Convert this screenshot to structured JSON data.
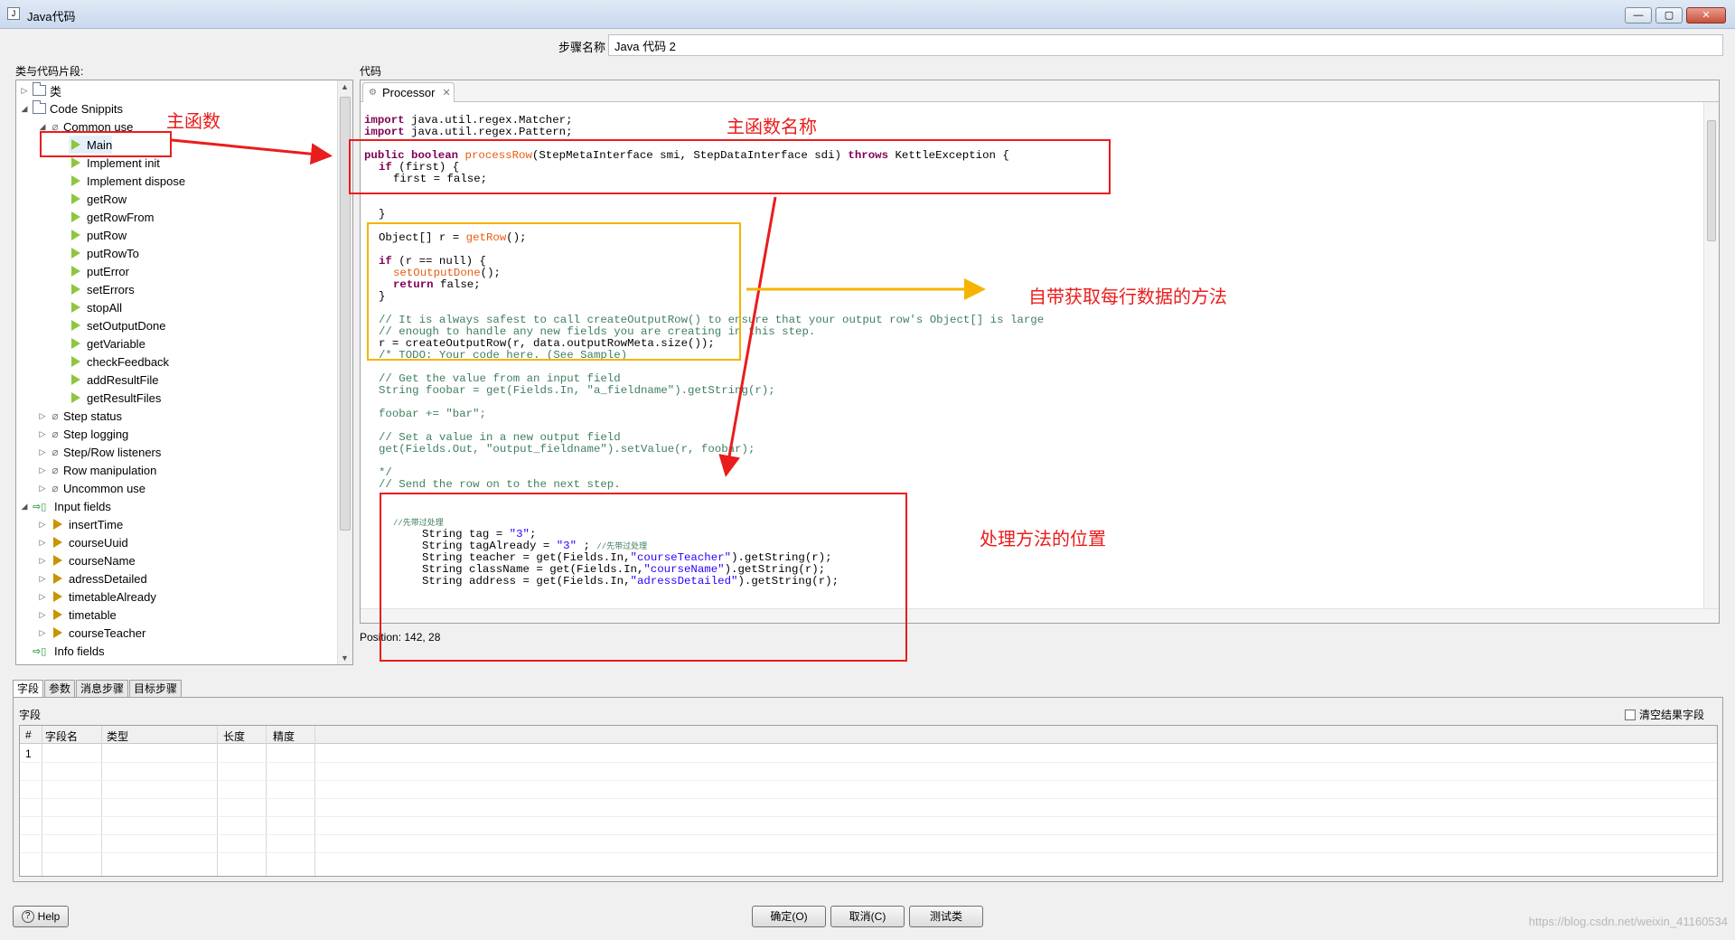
{
  "window": {
    "title": "Java代码",
    "minimize_icon": "minimize-icon",
    "maximize_icon": "maximize-icon",
    "close_icon": "close-icon"
  },
  "step_name": {
    "label": "步骤名称",
    "value": "Java 代码 2"
  },
  "left_panel": {
    "label": "类与代码片段:",
    "tree": [
      {
        "label": "类",
        "icon": "folder-icon"
      },
      {
        "label": "Code Snippits",
        "icon": "folder-icon"
      },
      {
        "label": "Common use",
        "icon": "clip-icon"
      },
      {
        "label": "Main",
        "icon": "snippet-icon"
      },
      {
        "label": "Implement init",
        "icon": "snippet-icon"
      },
      {
        "label": "Implement dispose",
        "icon": "snippet-icon"
      },
      {
        "label": "getRow",
        "icon": "snippet-icon"
      },
      {
        "label": "getRowFrom",
        "icon": "snippet-icon"
      },
      {
        "label": "putRow",
        "icon": "snippet-icon"
      },
      {
        "label": "putRowTo",
        "icon": "snippet-icon"
      },
      {
        "label": "putError",
        "icon": "snippet-icon"
      },
      {
        "label": "setErrors",
        "icon": "snippet-icon"
      },
      {
        "label": "stopAll",
        "icon": "snippet-icon"
      },
      {
        "label": "setOutputDone",
        "icon": "snippet-icon"
      },
      {
        "label": "getVariable",
        "icon": "snippet-icon"
      },
      {
        "label": "checkFeedback",
        "icon": "snippet-icon"
      },
      {
        "label": "addResultFile",
        "icon": "snippet-icon"
      },
      {
        "label": "getResultFiles",
        "icon": "snippet-icon"
      },
      {
        "label": "Step status",
        "icon": "clip-icon"
      },
      {
        "label": "Step logging",
        "icon": "clip-icon"
      },
      {
        "label": "Step/Row listeners",
        "icon": "clip-icon"
      },
      {
        "label": "Row manipulation",
        "icon": "clip-icon"
      },
      {
        "label": "Uncommon use",
        "icon": "clip-icon"
      },
      {
        "label": "Input fields",
        "icon": "fields-icon"
      },
      {
        "label": "insertTime",
        "icon": "field-icon"
      },
      {
        "label": "courseUuid",
        "icon": "field-icon"
      },
      {
        "label": "courseName",
        "icon": "field-icon"
      },
      {
        "label": "adressDetailed",
        "icon": "field-icon"
      },
      {
        "label": "timetableAlready",
        "icon": "field-icon"
      },
      {
        "label": "timetable",
        "icon": "field-icon"
      },
      {
        "label": "courseTeacher",
        "icon": "field-icon"
      },
      {
        "label": "Info fields",
        "icon": "fields-icon"
      }
    ]
  },
  "code_panel": {
    "label": "代码",
    "tab_label": "Processor",
    "position": "Position: 142, 28"
  },
  "code": {
    "l1_kw": "import",
    "l1_rest": " java.util.regex.Matcher;",
    "l2_kw": "import",
    "l2_rest": " java.util.regex.Pattern;",
    "l3_kw1": "public boolean",
    "l3_fn": "processRow",
    "l3_mid": "(StepMetaInterface smi, StepDataInterface sdi) ",
    "l3_kw2": "throws",
    "l3_rest": " KettleException {",
    "l4_kw": "if",
    "l4_rest": " (first) {",
    "l5": "first = false;",
    "l6": "}",
    "l7_a": "Object[] r = ",
    "l7_fn": "getRow",
    "l7_b": "();",
    "l8_kw": "if",
    "l8_rest": " (r == null) {",
    "l9_fn": "setOutputDone",
    "l9_rest": "();",
    "l10_kw": "return",
    "l10_rest": " false;",
    "l11": "}",
    "l12": "// It is always safest to call createOutputRow() to ensure that your output row's Object[] is large",
    "l13": "// enough to handle any new fields you are creating in this step.",
    "l14": "r = createOutputRow(r, data.outputRowMeta.size());",
    "l15": "/* TODO: Your code here. (See Sample)",
    "l16": "// Get the value from an input field",
    "l17_a": "String foobar = get(Fields.In, ",
    "l17_str": "\"a_fieldname\"",
    "l17_b": ").getString(r);",
    "l18_a": "foobar += ",
    "l18_str": "\"bar\"",
    "l18_b": ";",
    "l19": "// Set a value in a new output field",
    "l20_a": "get(Fields.Out, ",
    "l20_str": "\"output_fieldname\"",
    "l20_b": ").setValue(r, foobar);",
    "l21": "*/",
    "l22": "// Send the row on to the next step.",
    "l23": "//先带过处理",
    "l24_a": "String tag = ",
    "l24_str": "\"3\"",
    "l24_b": ";",
    "l25_a": "String tagAlready = ",
    "l25_str": "\"3\"",
    "l25_b": " ; ",
    "l25_cmt": "//先带过处理",
    "l26_a": "String teacher = get(Fields.In,",
    "l26_str": "\"courseTeacher\"",
    "l26_b": ").getString(r);",
    "l27_a": "String className = get(Fields.In,",
    "l27_str": "\"courseName\"",
    "l27_b": ").getString(r);",
    "l28_a": "String address = get(Fields.In,",
    "l28_str": "\"adressDetailed\"",
    "l28_b": ").getString(r);"
  },
  "lower": {
    "tabs": [
      "字段",
      "参数",
      "消息步骤",
      "目标步骤"
    ],
    "fields_label": "字段",
    "clear_label": "清空结果字段",
    "columns": [
      "#",
      "字段名",
      "类型",
      "长度",
      "精度"
    ],
    "rows": [
      "1"
    ]
  },
  "buttons": {
    "help": "Help",
    "ok": "确定(O)",
    "cancel": "取消(C)",
    "test": "测试类"
  },
  "annotations": {
    "main_func": "主函数",
    "main_func_name": "主函数名称",
    "row_method": "自带获取每行数据的方法",
    "process_location": "处理方法的位置"
  },
  "watermark": "https://blog.csdn.net/weixin_41160534",
  "colors": {
    "annotation_red": "#ea1c1c",
    "annotation_yellow": "#f5b400",
    "keyword": "#7f0055",
    "string": "#2a00ff",
    "comment": "#3f7f5f",
    "method": "#e85c10"
  }
}
